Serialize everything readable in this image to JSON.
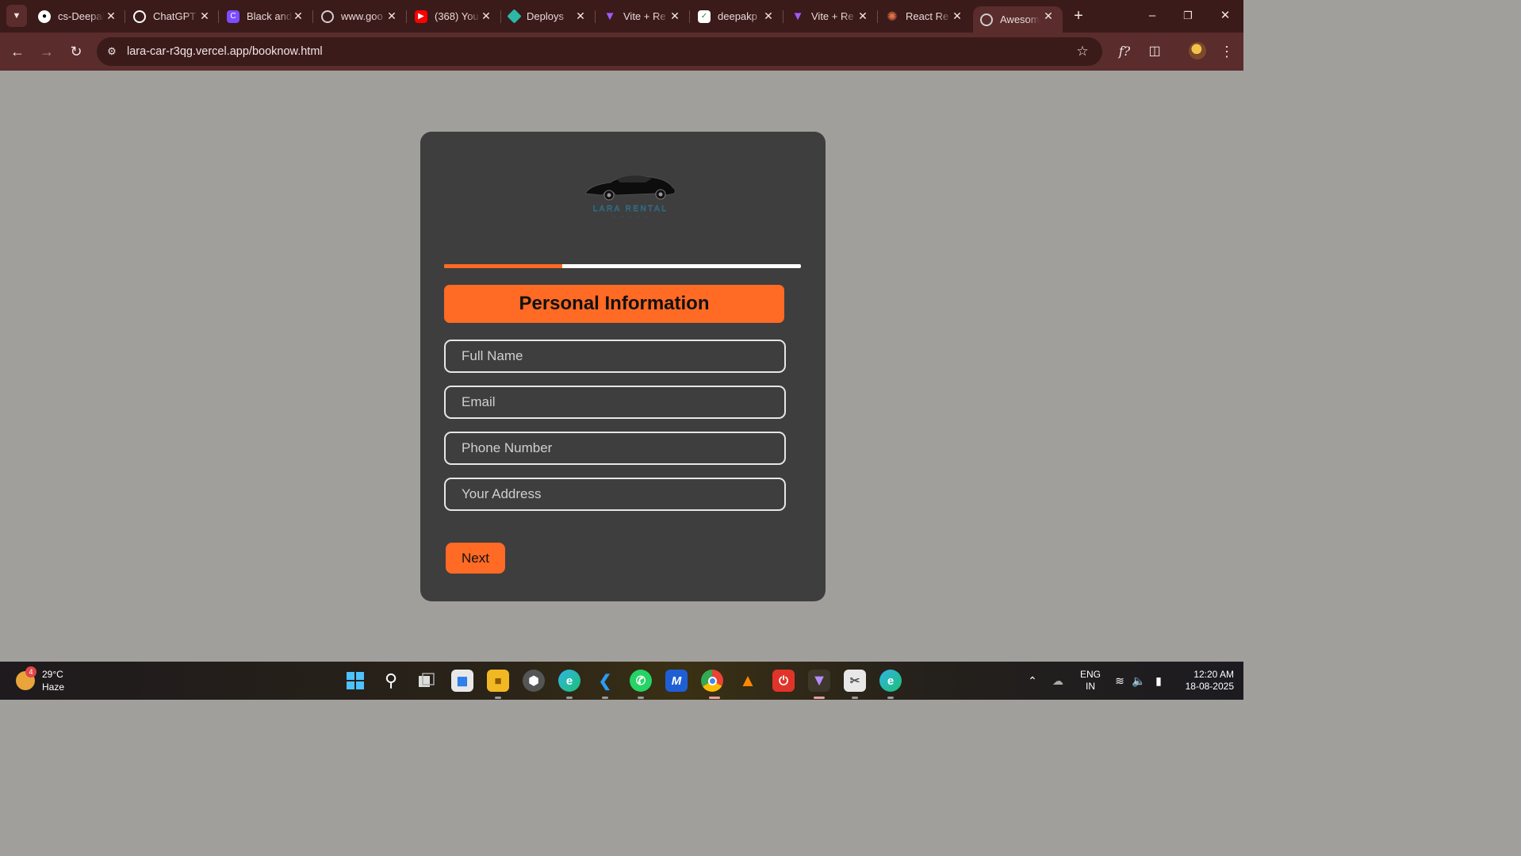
{
  "browser": {
    "tabs": [
      {
        "title": "cs-Deepak",
        "icon": "github-icon",
        "color": "#ffffff"
      },
      {
        "title": "ChatGPT",
        "icon": "chatgpt-icon",
        "color": "#ffffff"
      },
      {
        "title": "Black and",
        "icon": "canva-icon",
        "color": "#7b4dff"
      },
      {
        "title": "www.goo",
        "icon": "globe-icon",
        "color": "#cfcfcf"
      },
      {
        "title": "(368) You",
        "icon": "youtube-icon",
        "color": "#ff0000"
      },
      {
        "title": "Deploys",
        "icon": "netlify-icon",
        "color": "#2bb8a6"
      },
      {
        "title": "Vite + Re",
        "icon": "vite-icon",
        "color": "#a259ff"
      },
      {
        "title": "deepakp",
        "icon": "vercel-deploy-icon",
        "color": "#ffffff"
      },
      {
        "title": "Vite + Re",
        "icon": "vite-icon",
        "color": "#a259ff"
      },
      {
        "title": "React Re",
        "icon": "claude-icon",
        "color": "#e0704a"
      },
      {
        "title": "Awesome",
        "icon": "globe-icon",
        "color": "#cfcfcf",
        "active": true
      }
    ],
    "url": "lara-car-r3qg.vercel.app/booknow.html"
  },
  "page": {
    "logo_text": "LARA RENTAL",
    "progress_percent": 33,
    "section_title": "Personal Information",
    "fields": {
      "full_name": {
        "placeholder": "Full Name",
        "value": ""
      },
      "email": {
        "placeholder": "Email",
        "value": ""
      },
      "phone": {
        "placeholder": "Phone Number",
        "value": ""
      },
      "address": {
        "placeholder": "Your Address",
        "value": ""
      }
    },
    "next_label": "Next"
  },
  "taskbar": {
    "weather": {
      "temp": "29°C",
      "condition": "Haze",
      "badge": "4"
    },
    "language": {
      "line1": "ENG",
      "line2": "IN"
    },
    "time": "12:20 AM",
    "date": "18-08-2025"
  },
  "colors": {
    "accent": "#ff6a24",
    "card": "#3e3e3f",
    "page_bg": "#a19f9c",
    "chrome": "#5a2c2c"
  }
}
